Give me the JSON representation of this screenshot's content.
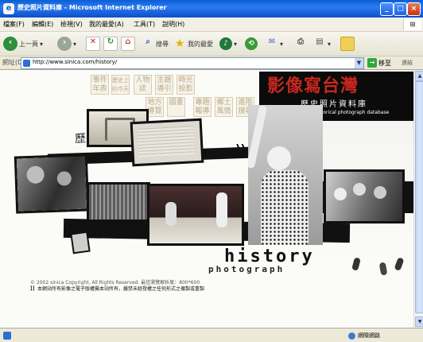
{
  "window": {
    "title": "歷史照片資料庫 - Microsoft Internet Explorer",
    "min": "_",
    "max": "□",
    "close": "×"
  },
  "menu": {
    "items": [
      "檔案(F)",
      "編輯(E)",
      "檢視(V)",
      "我的最愛(A)",
      "工具(T)",
      "說明(H)"
    ]
  },
  "toolbar": {
    "back_label": "上一頁",
    "search_label": "搜尋",
    "favorites_label": "我的最愛"
  },
  "address": {
    "label": "網址(D)",
    "url": "http://www.sinica.com/history/",
    "go_label": "移至",
    "links_label": "連結"
  },
  "page": {
    "nav_buttons": [
      "事件年表",
      "歷史上的今天",
      "人物誌",
      "主題導引",
      "時光投影",
      "地方導覽",
      "國畫",
      "專題報導",
      "鄉土風情",
      "進階搜尋"
    ],
    "logo_title": "影像寫台灣",
    "logo_subtitle": "歷史照片資料庫",
    "logo_english": "Taiwan memory-historical photograph database",
    "hand_title": "歷史照片",
    "history_word": "history",
    "photograph_word": "photograph",
    "copyright": "© 2002 sinica Copyright, All Rights Reserved. 最佳瀏覽解析度：800*600",
    "notice": "】】本網站所有影像之電子版權屬本站所有，嚴禁未經授權之任何形式之複製或重製",
    "quote_marks": "))"
  },
  "status": {
    "zone": "網際網路"
  },
  "colors": {
    "titlebar": "#0a5fd6",
    "logo_red": "#c8281e",
    "ink": "#111111"
  }
}
